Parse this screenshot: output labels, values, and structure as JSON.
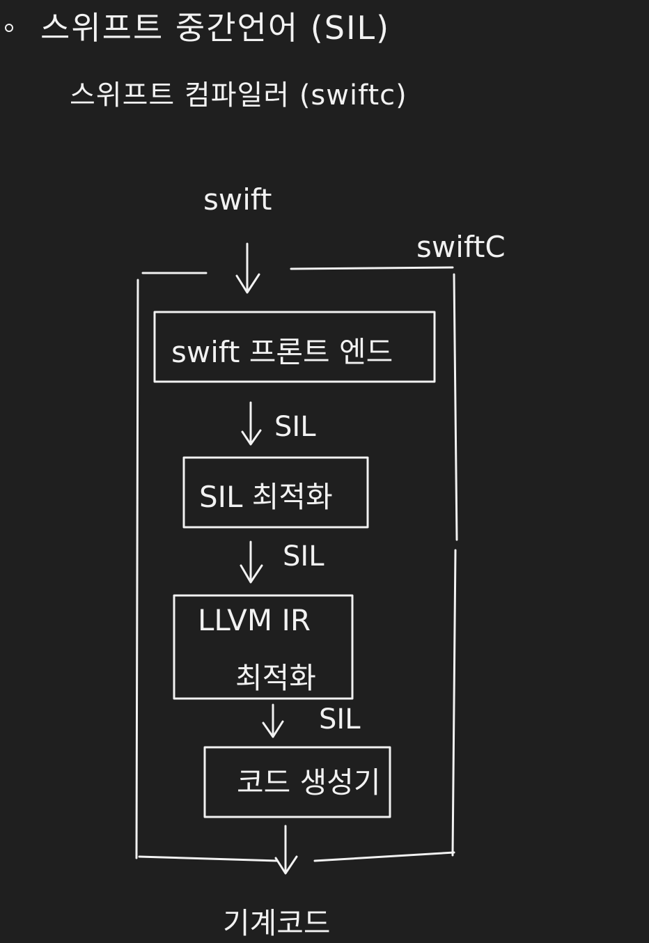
{
  "header": {
    "bullet_title": "스위프트 중간언어 (SIL)",
    "subtitle": "스위프트 컴파일러 (swiftc)"
  },
  "diagram": {
    "input_label": "swift",
    "container_label": "swiftC",
    "stages": [
      {
        "label": "swift 프론트 엔드"
      },
      {
        "label": "SIL 최적화"
      },
      {
        "label_line1": "LLVM IR",
        "label_line2": "최적화"
      },
      {
        "label": "코드 생성기"
      }
    ],
    "edge_labels": [
      "SIL",
      "SIL",
      "SIL"
    ],
    "output_label": "기계코드"
  }
}
